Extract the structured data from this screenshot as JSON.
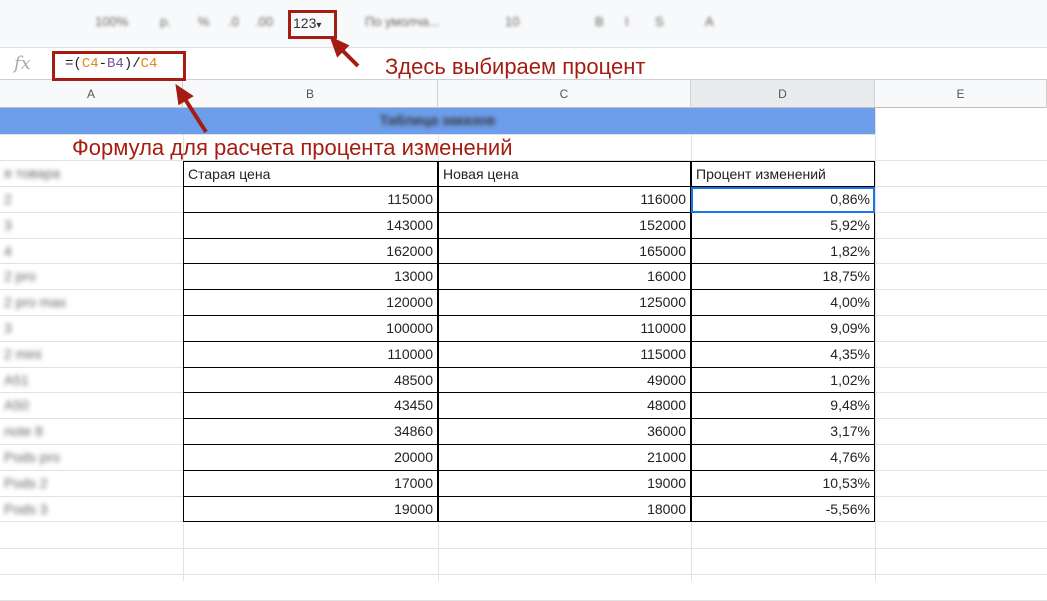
{
  "toolbar": {
    "items": [
      "100%",
      "р.",
      "%",
      ".0",
      ".00",
      "По умолча...",
      "10",
      "B",
      "I",
      "S",
      "A"
    ],
    "number_format_button": "123",
    "dropdown": "▾"
  },
  "formula_bar": {
    "fx": "fx",
    "parts": [
      {
        "t": "=(",
        "c": "#222"
      },
      {
        "t": "C4",
        "c": "#e0891a"
      },
      {
        "t": "-",
        "c": "#222"
      },
      {
        "t": "B4",
        "c": "#7a4fa0"
      },
      {
        "t": ")/",
        "c": "#222"
      },
      {
        "t": "C4",
        "c": "#e0891a"
      }
    ]
  },
  "columns": [
    "A",
    "B",
    "C",
    "D",
    "E"
  ],
  "sheet": {
    "title": "Таблица заказов",
    "headers": [
      "я товара",
      "Старая цена",
      "Новая цена",
      "Процент изменений"
    ],
    "rows": [
      [
        "2",
        "115000",
        "116000",
        "0,86%"
      ],
      [
        "3",
        "143000",
        "152000",
        "5,92%"
      ],
      [
        "4",
        "162000",
        "165000",
        "1,82%"
      ],
      [
        "2 pro",
        "13000",
        "16000",
        "18,75%"
      ],
      [
        "2 pro max",
        "120000",
        "125000",
        "4,00%"
      ],
      [
        "3",
        "100000",
        "110000",
        "9,09%"
      ],
      [
        "2 mini",
        "110000",
        "115000",
        "4,35%"
      ],
      [
        "A51",
        "48500",
        "49000",
        "1,02%"
      ],
      [
        "A50",
        "43450",
        "48000",
        "9,48%"
      ],
      [
        "note 8",
        "34860",
        "36000",
        "3,17%"
      ],
      [
        "Pods pro",
        "20000",
        "21000",
        "4,76%"
      ],
      [
        "Pods 2",
        "17000",
        "19000",
        "10,53%"
      ],
      [
        "Pods 3",
        "19000",
        "18000",
        "-5,56%"
      ]
    ]
  },
  "annotations": {
    "number_format": "Здесь выбираем процент",
    "formula": "Формула для расчета процента изменений"
  },
  "colors": {
    "accent": "#a51d12",
    "title_band": "#6d9eeb",
    "selection": "#1a73e8"
  }
}
